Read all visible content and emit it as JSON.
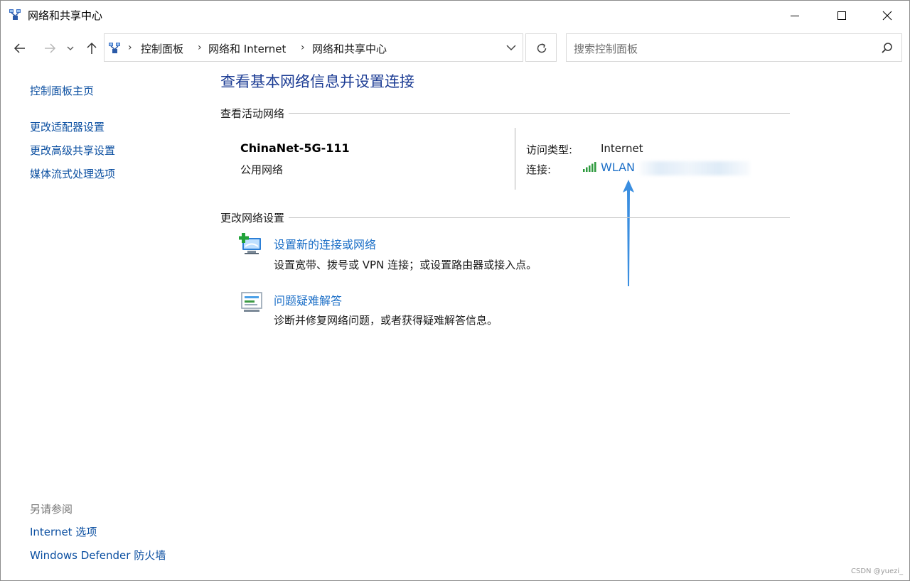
{
  "window": {
    "title": "网络和共享中心",
    "icon": "network-center-icon"
  },
  "address_bar": {
    "crumbs": [
      "控制面板",
      "网络和 Internet",
      "网络和共享中心"
    ]
  },
  "search": {
    "placeholder": "搜索控制面板"
  },
  "sidebar": {
    "home": "控制面板主页",
    "links": [
      "更改适配器设置",
      "更改高级共享设置",
      "媒体流式处理选项"
    ],
    "see_also_title": "另请参阅",
    "see_also": [
      "Internet 选项",
      "Windows Defender 防火墙"
    ]
  },
  "main": {
    "title": "查看基本网络信息并设置连接",
    "active_networks": {
      "heading": "查看活动网络",
      "name": "ChinaNet-5G-111",
      "category": "公用网络",
      "access_type_label": "访问类型:",
      "access_type_value": "Internet",
      "connection_label": "连接:",
      "connection_value": "WLAN"
    },
    "change_settings": {
      "heading": "更改网络设置",
      "tasks": [
        {
          "title": "设置新的连接或网络",
          "desc": "设置宽带、拨号或 VPN 连接；或设置路由器或接入点。",
          "icon": "new-connection-icon"
        },
        {
          "title": "问题疑难解答",
          "desc": "诊断并修复网络问题，或者获得疑难解答信息。",
          "icon": "troubleshoot-icon"
        }
      ]
    }
  },
  "colors": {
    "link": "#1c6fc7",
    "title": "#1c3c94",
    "arrow": "#3a8ee0"
  },
  "watermark": "CSDN @yuezi_"
}
